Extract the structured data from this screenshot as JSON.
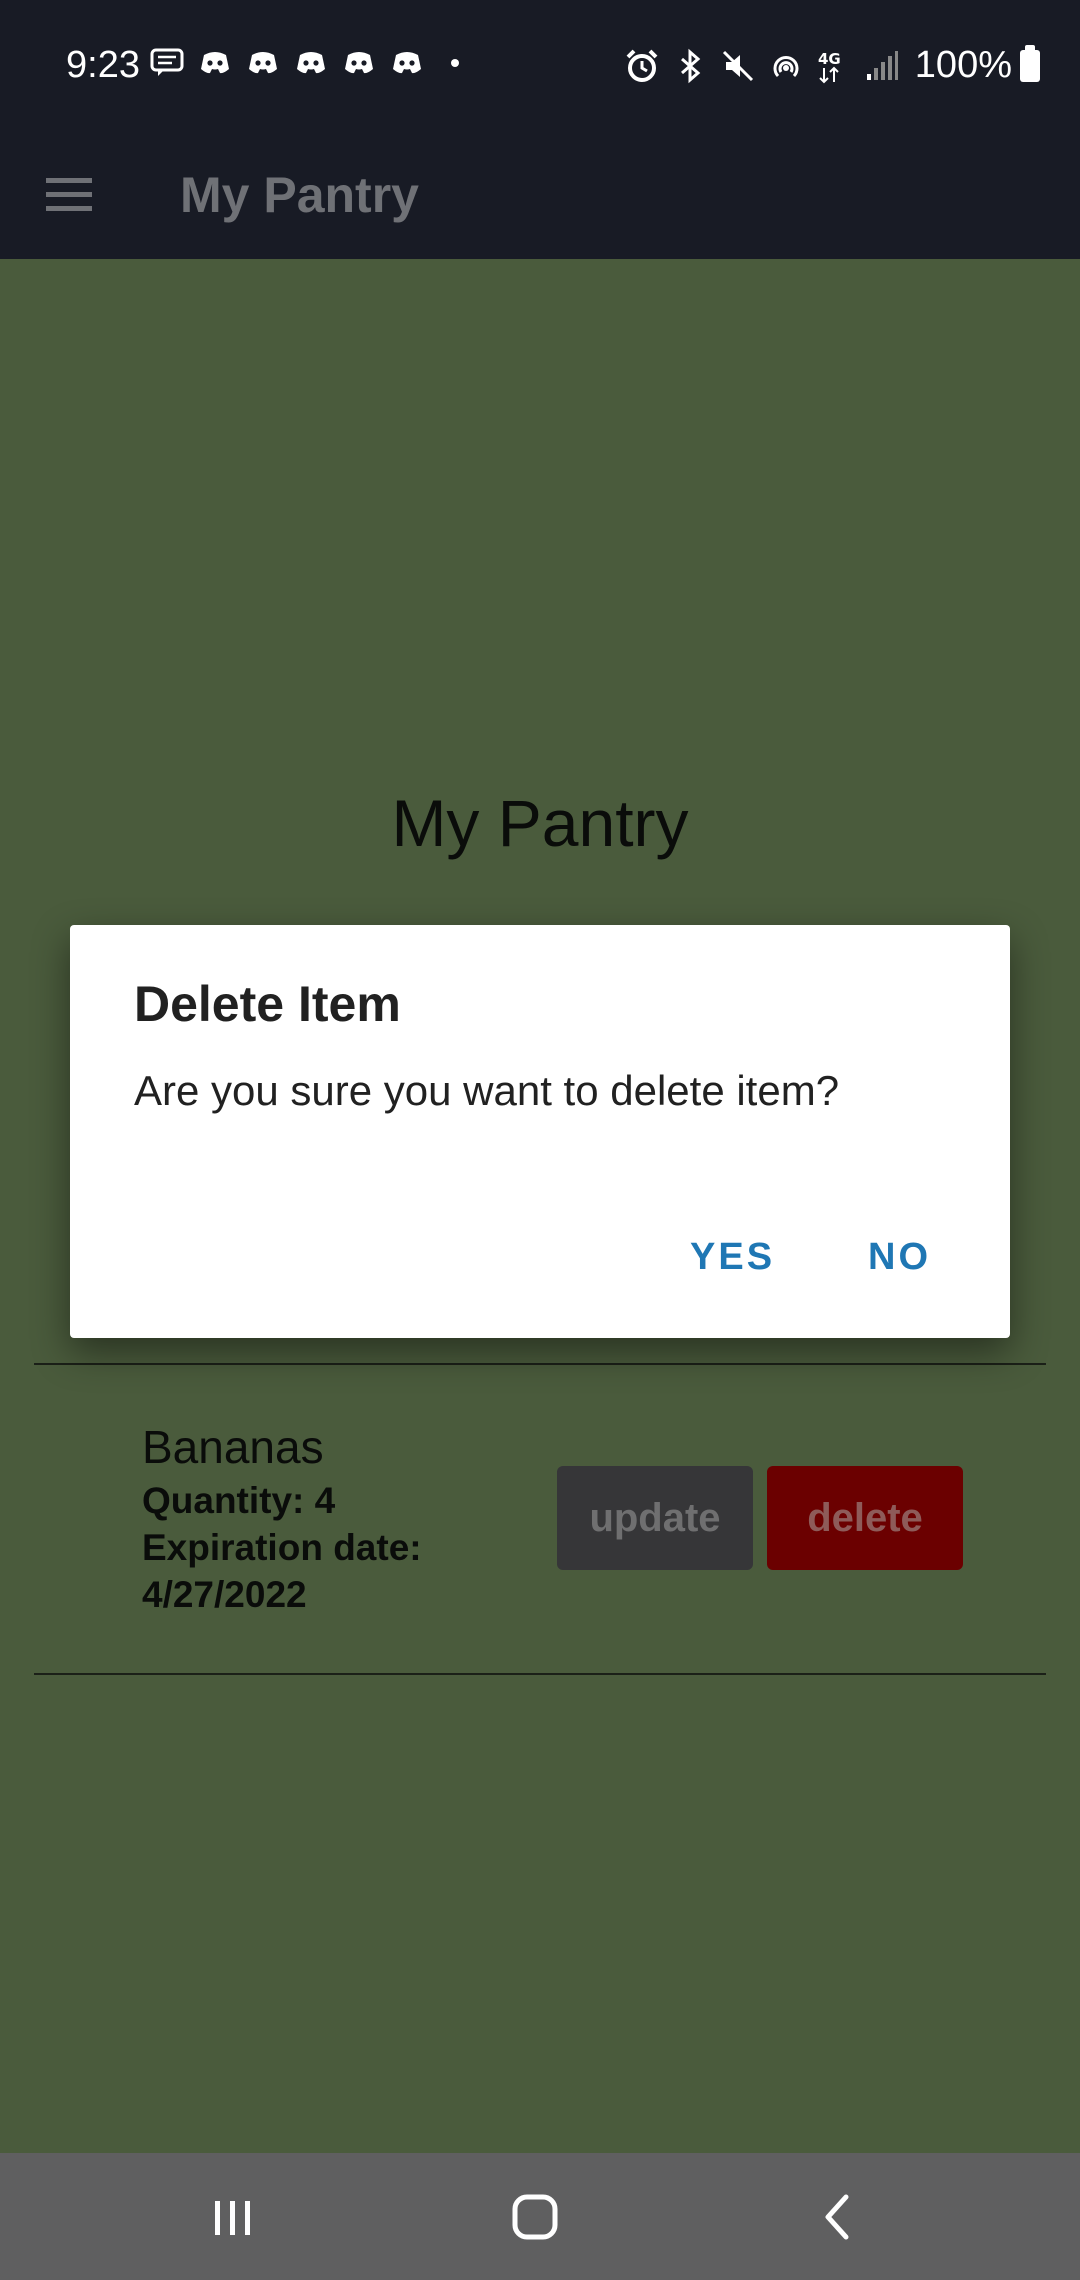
{
  "status_bar": {
    "time": "9:23",
    "battery": "100%",
    "notification_icons": [
      "message-icon",
      "discord-icon",
      "discord-icon",
      "discord-icon",
      "discord-icon",
      "discord-icon",
      "dot-icon"
    ],
    "system_icons": [
      "alarm-icon",
      "bluetooth-icon",
      "mute-icon",
      "hotspot-icon",
      "4g-icon",
      "signal-icon"
    ]
  },
  "app_bar": {
    "title": "My Pantry",
    "menu_icon": "hamburger-menu-icon"
  },
  "main": {
    "heading": "My Pantry",
    "items": [
      {
        "name": "Bananas",
        "quantity": "Quantity: 4",
        "expiration_label": "Expiration date:",
        "expiration_value": "4/27/2022",
        "update_label": "update",
        "delete_label": "delete"
      }
    ]
  },
  "dialog": {
    "title": "Delete Item",
    "message": "Are you sure you want to delete item?",
    "yes_label": "YES",
    "no_label": "NO"
  },
  "nav_bar": {
    "buttons": [
      "recent-apps-icon",
      "home-icon",
      "back-icon"
    ]
  },
  "colors": {
    "background": "#4a5b3c",
    "app_bar": "#181b25",
    "update_button": "#363638",
    "delete_button": "#6b0000",
    "dialog_action": "#1f77b4",
    "nav_bar": "#5f5f60"
  }
}
